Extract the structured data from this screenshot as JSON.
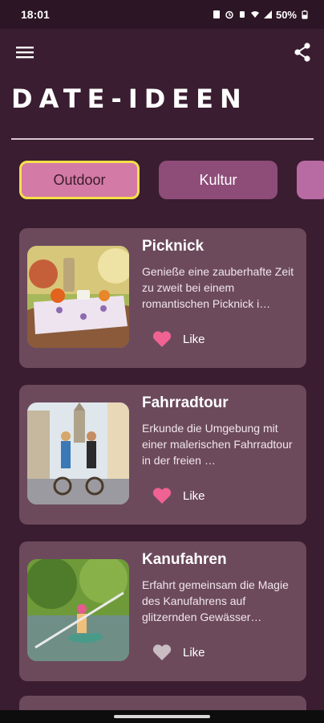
{
  "status_bar": {
    "time": "18:01",
    "battery": "50%",
    "icons": [
      "sim-icon",
      "alarm-icon",
      "vibrate-icon",
      "wifi-icon",
      "signal-icon",
      "battery-icon"
    ]
  },
  "app_bar": {
    "menu_icon": "hamburger-menu-icon",
    "share_icon": "share-icon"
  },
  "page": {
    "title": "DATE-IDEEN"
  },
  "categories": [
    {
      "label": "Outdoor",
      "selected": true
    },
    {
      "label": "Kultur",
      "selected": false
    },
    {
      "label": "",
      "selected": false
    }
  ],
  "ideas": [
    {
      "title": "Picknick",
      "description": "Genieße eine zauberhafte Zeit zu zweit bei einem romantischen Picknick i…",
      "like_label": "Like",
      "liked": true
    },
    {
      "title": "Fahrradtour",
      "description": "Erkunde die Umgebung mit einer malerischen Fahrradtour in der freien …",
      "like_label": "Like",
      "liked": true
    },
    {
      "title": "Kanufahren",
      "description": "Erfahrt gemeinsam die Magie des Kanufahrens auf glitzernden Gewässer…",
      "like_label": "Like",
      "liked": false
    }
  ],
  "colors": {
    "background": "#3a1d30",
    "card": "#6c4a5c",
    "chip_active": "#d47aa6",
    "chip_active_border": "#f5e04a",
    "chip": "#8e4c79",
    "heart_liked": "#f06292",
    "heart_unliked": "#c9bcc3"
  }
}
